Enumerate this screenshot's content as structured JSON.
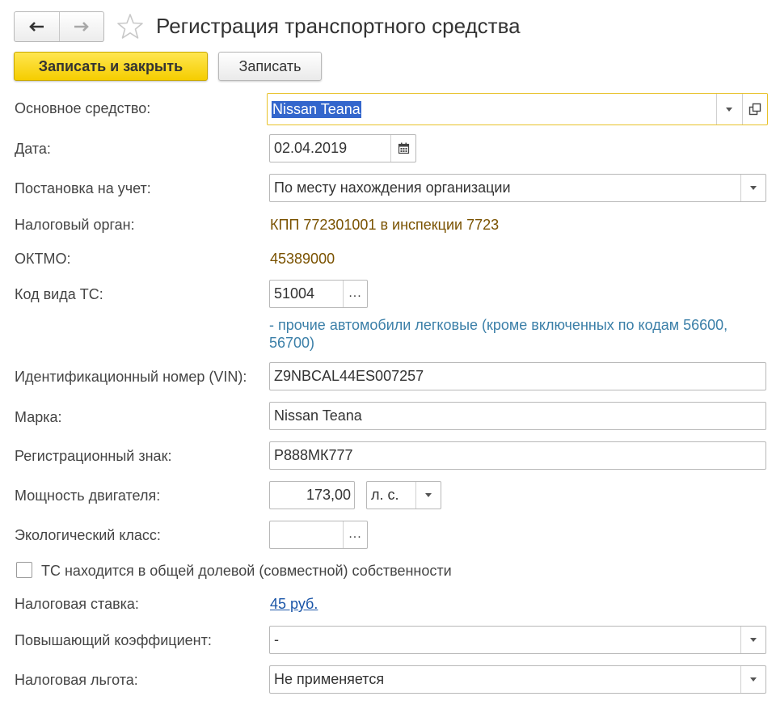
{
  "window": {
    "title": "Регистрация транспортного средства"
  },
  "toolbar": {
    "save_close_label": "Записать и закрыть",
    "save_label": "Записать"
  },
  "form": {
    "asset": {
      "label": "Основное средство:",
      "value": "Nissan Teana"
    },
    "date": {
      "label": "Дата:",
      "value": "02.04.2019"
    },
    "registration": {
      "label": "Постановка на учет:",
      "value": "По месту нахождения организации"
    },
    "tax_authority": {
      "label": "Налоговый орган:",
      "value": "КПП 772301001 в инспекции 7723"
    },
    "oktmo": {
      "label": "ОКТМО:",
      "value": "45389000"
    },
    "vehicle_code": {
      "label": "Код вида ТС:",
      "value": "51004",
      "button": "...",
      "description": "- прочие автомобили легковые (кроме включенных по кодам 56600, 56700)"
    },
    "vin": {
      "label": "Идентификационный номер (VIN):",
      "value": "Z9NBCAL44ES007257"
    },
    "brand": {
      "label": "Марка:",
      "value": "Nissan Teana"
    },
    "reg_sign": {
      "label": "Регистрационный знак:",
      "value": "Р888МК777"
    },
    "power": {
      "label": "Мощность двигателя:",
      "value": "173,00",
      "unit": "л. с."
    },
    "eco_class": {
      "label": "Экологический класс:",
      "value": "",
      "button": "..."
    },
    "shared_ownership": {
      "label": "ТС находится в общей долевой (совместной) собственности",
      "checked": false
    },
    "tax_rate": {
      "label": "Налоговая ставка:",
      "value": "45 руб."
    },
    "coefficient": {
      "label": "Повышающий коэффициент:",
      "value": "-"
    },
    "benefit": {
      "label": "Налоговая льгота:",
      "value": "Не применяется"
    }
  },
  "icons": {
    "back": "arrow-left-icon",
    "forward": "arrow-right-icon",
    "favorite": "star-icon",
    "calendar": "calendar-icon",
    "open": "open-form-icon",
    "dropdown": "chevron-down-icon"
  },
  "colors": {
    "primary_button": "#f5cd00",
    "focus_border": "#e8c22a",
    "link": "#1a55a8",
    "info_brown": "#7a5200",
    "info_blue": "#3b7fa8"
  }
}
